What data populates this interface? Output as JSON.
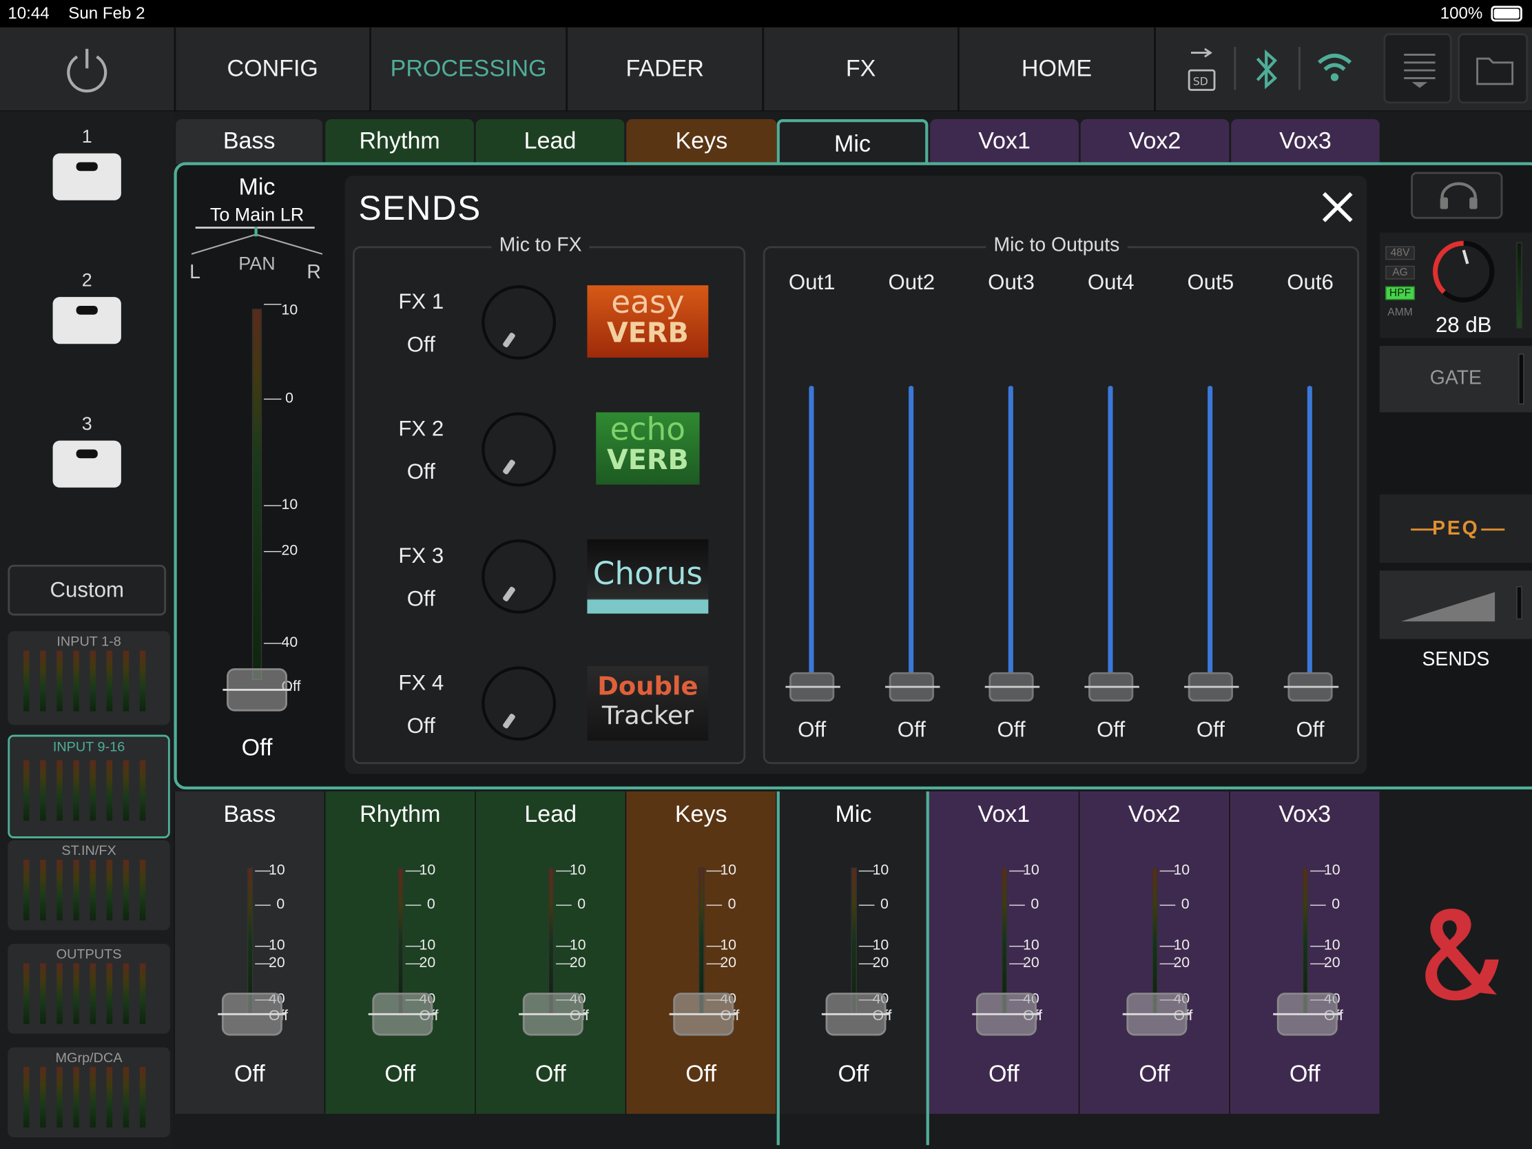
{
  "statusbar": {
    "time": "10:44",
    "date": "Sun Feb 2",
    "battery": "100%"
  },
  "nav": {
    "items": [
      "CONFIG",
      "PROCESSING",
      "FADER",
      "FX",
      "HOME"
    ],
    "active": "PROCESSING",
    "accent": "#4fae98"
  },
  "scenes": [
    "1",
    "2",
    "3"
  ],
  "custom_label": "Custom",
  "banks": [
    "INPUT 1-8",
    "INPUT 9-16",
    "ST.IN/FX",
    "OUTPUTS",
    "MGrp/DCA"
  ],
  "tabs": [
    {
      "label": "Bass",
      "color": "#2c2d2f"
    },
    {
      "label": "Rhythm",
      "color": "#1d4023"
    },
    {
      "label": "Lead",
      "color": "#1d4023"
    },
    {
      "label": "Keys",
      "color": "#5a3514"
    },
    {
      "label": "Mic",
      "color": "#1f2022"
    },
    {
      "label": "Vox1",
      "color": "#3f2a4f"
    },
    {
      "label": "Vox2",
      "color": "#3f2a4f"
    },
    {
      "label": "Vox3",
      "color": "#3f2a4f"
    }
  ],
  "channel": {
    "name": "Mic",
    "dest": "To Main LR",
    "pan_label": "PAN",
    "pan_left": "L",
    "pan_right": "R",
    "scale": [
      "10",
      "0",
      "10",
      "20",
      "40",
      "Off"
    ],
    "value": "Off"
  },
  "sends": {
    "title": "SENDS",
    "fx_group": "Mic to FX",
    "out_group": "Mic to Outputs",
    "fx": [
      {
        "name": "FX 1",
        "value": "Off",
        "logo_top": "easy",
        "logo_bottom": "VERB"
      },
      {
        "name": "FX 2",
        "value": "Off",
        "logo_top": "echo",
        "logo_bottom": "VERB"
      },
      {
        "name": "FX 3",
        "value": "Off",
        "logo_top": "Chorus",
        "logo_bottom": ""
      },
      {
        "name": "FX 4",
        "value": "Off",
        "logo_top": "Double",
        "logo_bottom": "Tracker"
      }
    ],
    "outputs": [
      {
        "name": "Out1",
        "value": "Off"
      },
      {
        "name": "Out2",
        "value": "Off"
      },
      {
        "name": "Out3",
        "value": "Off"
      },
      {
        "name": "Out4",
        "value": "Off"
      },
      {
        "name": "Out5",
        "value": "Off"
      },
      {
        "name": "Out6",
        "value": "Off"
      }
    ]
  },
  "right": {
    "flags": [
      "48V",
      "AG",
      "HPF",
      "AMM"
    ],
    "gain": "28 dB",
    "gate": "GATE",
    "peq": "PEQ",
    "sends": "SENDS"
  },
  "strips": [
    {
      "name": "Bass",
      "value": "Off"
    },
    {
      "name": "Rhythm",
      "value": "Off"
    },
    {
      "name": "Lead",
      "value": "Off"
    },
    {
      "name": "Keys",
      "value": "Off"
    },
    {
      "name": "Mic",
      "value": "Off"
    },
    {
      "name": "Vox1",
      "value": "Off"
    },
    {
      "name": "Vox2",
      "value": "Off"
    },
    {
      "name": "Vox3",
      "value": "Off"
    }
  ],
  "strip_scale": [
    "10",
    "0",
    "10",
    "20",
    "40",
    "Off"
  ]
}
